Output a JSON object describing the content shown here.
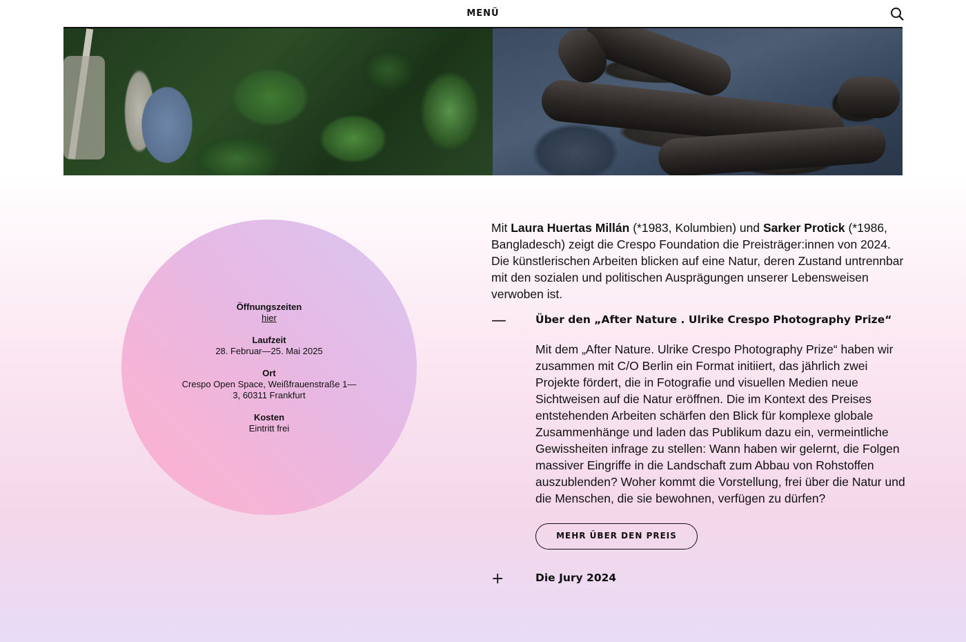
{
  "header": {
    "menu_label": "MENÜ",
    "search_icon": "search-icon"
  },
  "hero": {
    "images": [
      "forest-still",
      "logs-still"
    ]
  },
  "info": {
    "hours_label": "Öffnungszeiten",
    "hours_link": "hier",
    "runtime_label": "Laufzeit",
    "runtime_value": "28. Februar—25. Mai 2025",
    "location_label": "Ort",
    "location_line1": "Crespo Open Space, Weißfrauenstraße 1—",
    "location_line2": "3, 60311 Frankfurt",
    "cost_label": "Kosten",
    "cost_value": "Eintritt frei"
  },
  "intro": {
    "t1": "Mit ",
    "artist1": "Laura Huertas Millán",
    "t2": " (*1983, Kolumbien) und ",
    "artist2": "Sarker Protick",
    "t3": " (*1986, Bangladesch) zeigt die Crespo Foundation die Preisträger:innen von 2024. Die künstlerischen Arbeiten blicken auf eine Natur, deren Zustand untrennbar mit den sozialen und politischen Ausprägungen unserer Lebensweisen verwoben ist."
  },
  "accordion": [
    {
      "sign": "—",
      "title": "Über den „After Nature . Ulrike Crespo Photography Prize“",
      "body": "Mit dem „After Nature. Ulrike Crespo Photography Prize“ haben wir zusammen mit C/O Berlin ein Format initiiert, das jährlich zwei Projekte fördert, die in Fotografie und visuellen Medien neue Sichtweisen auf die Natur eröffnen. Die im Kontext des Preises entstehenden Arbeiten schärfen den Blick für komplexe globale Zusammenhänge und laden das Publikum dazu ein, vermeintliche Gewissheiten infrage zu stellen: Wann haben wir gelernt, die Folgen massiver Eingriffe in die Landschaft zum Abbau von Rohstoffen auszublenden? Woher kommt die Vorstellung, frei über die Natur und die Menschen, die sie bewohnen, verfügen zu dürfen?",
      "button": "MEHR ÜBER DEN PREIS",
      "expanded": true
    },
    {
      "sign": "+",
      "title": "Die Jury 2024",
      "expanded": false
    }
  ]
}
